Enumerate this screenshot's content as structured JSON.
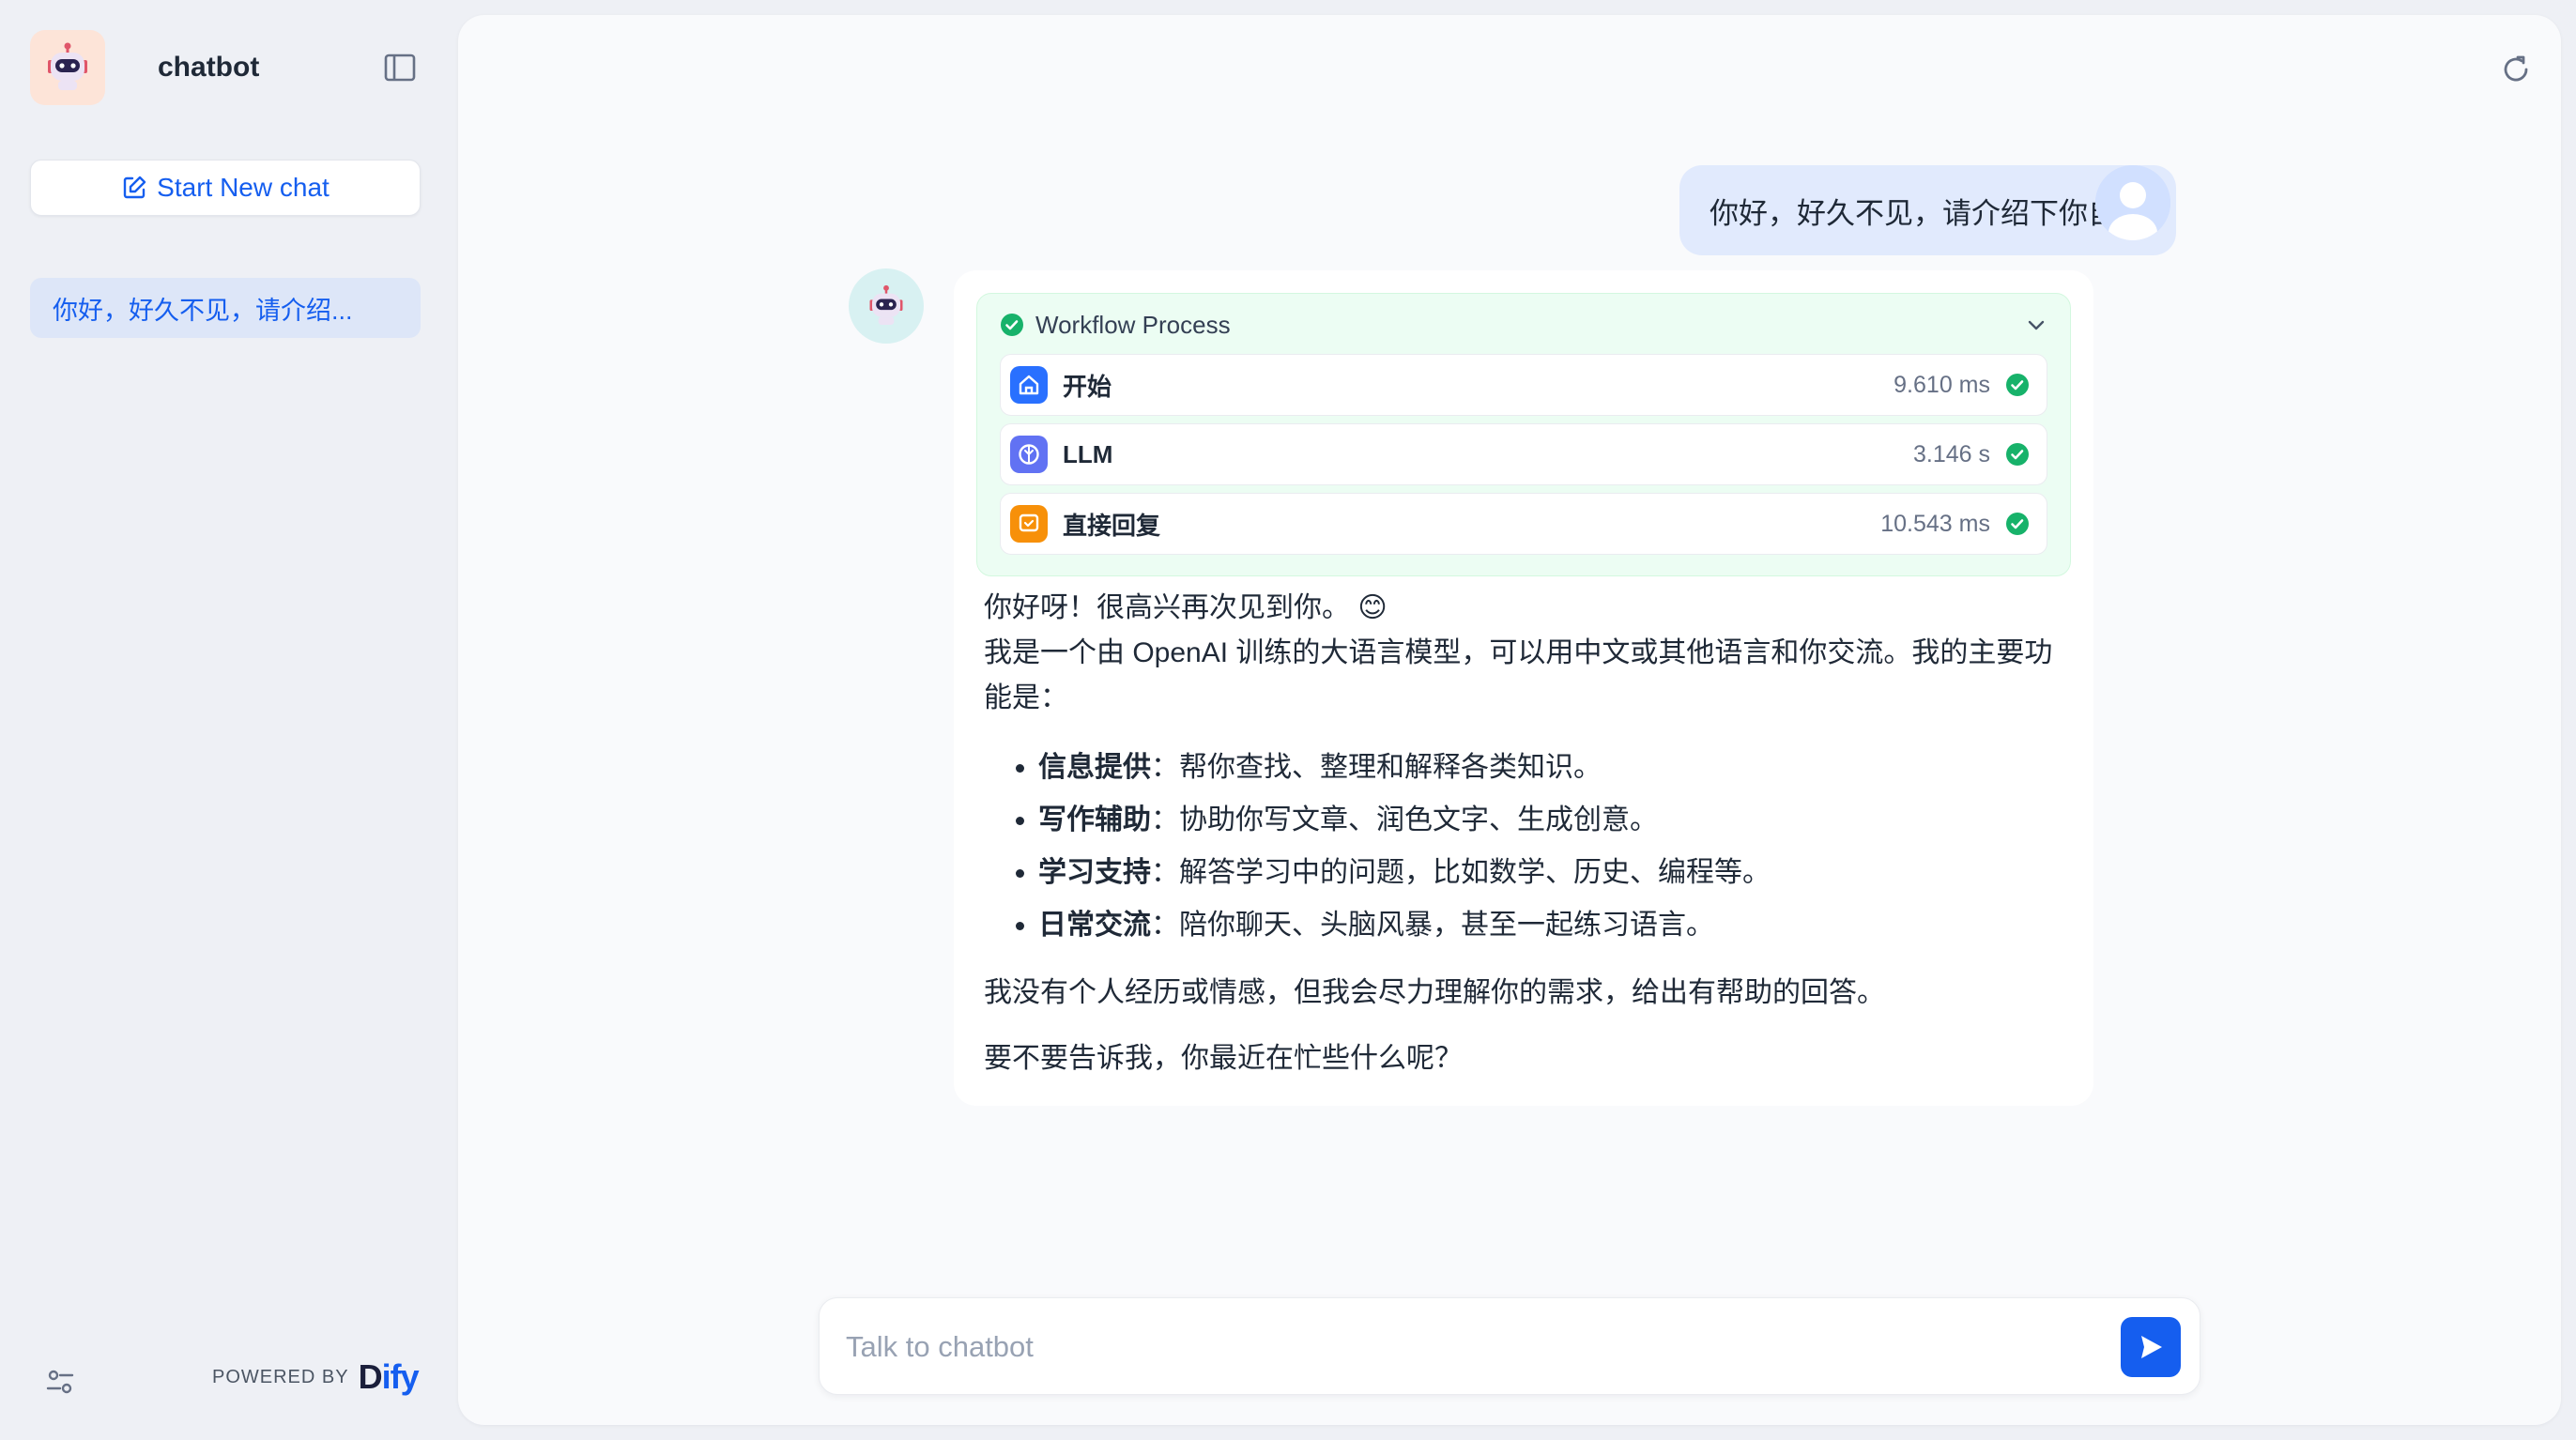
{
  "sidebar": {
    "app_name": "chatbot",
    "new_chat_label": "Start New chat",
    "conversations": [
      {
        "title": "你好，好久不见，请介绍..."
      }
    ],
    "powered_by": "POWERED BY",
    "brand": "Dify"
  },
  "chat": {
    "user_message": "你好，好久不见，请介绍下你自己",
    "workflow": {
      "title": "Workflow Process",
      "nodes": [
        {
          "title": "开始",
          "time": "9.610 ms",
          "icon": "home-icon",
          "color": "#2970ff"
        },
        {
          "title": "LLM",
          "time": "3.146 s",
          "icon": "llm-icon",
          "color": "#6172f3"
        },
        {
          "title": "直接回复",
          "time": "10.543 ms",
          "icon": "answer-icon",
          "color": "#f79009"
        }
      ]
    },
    "answer": {
      "greeting": "你好呀！很高兴再次见到你。",
      "greeting_emoji": "😊",
      "intro": "我是一个由 OpenAI 训练的大语言模型，可以用中文或其他语言和你交流。我的主要功能是：",
      "features": [
        {
          "title": "信息提供",
          "desc": "：帮你查找、整理和解释各类知识。"
        },
        {
          "title": "写作辅助",
          "desc": "：协助你写文章、润色文字、生成创意。"
        },
        {
          "title": "学习支持",
          "desc": "：解答学习中的问题，比如数学、历史、编程等。"
        },
        {
          "title": "日常交流",
          "desc": "：陪你聊天、头脑风暴，甚至一起练习语言。"
        }
      ],
      "disclaimer": "我没有个人经历或情感，但我会尽力理解你的需求，给出有帮助的回答。",
      "question": "要不要告诉我，你最近在忙些什么呢？"
    },
    "input": {
      "placeholder": "Talk to chatbot",
      "value": ""
    }
  },
  "colors": {
    "accent": "#155eef",
    "success": "#17b26a",
    "workflow_bg": "#ecfdf3"
  }
}
